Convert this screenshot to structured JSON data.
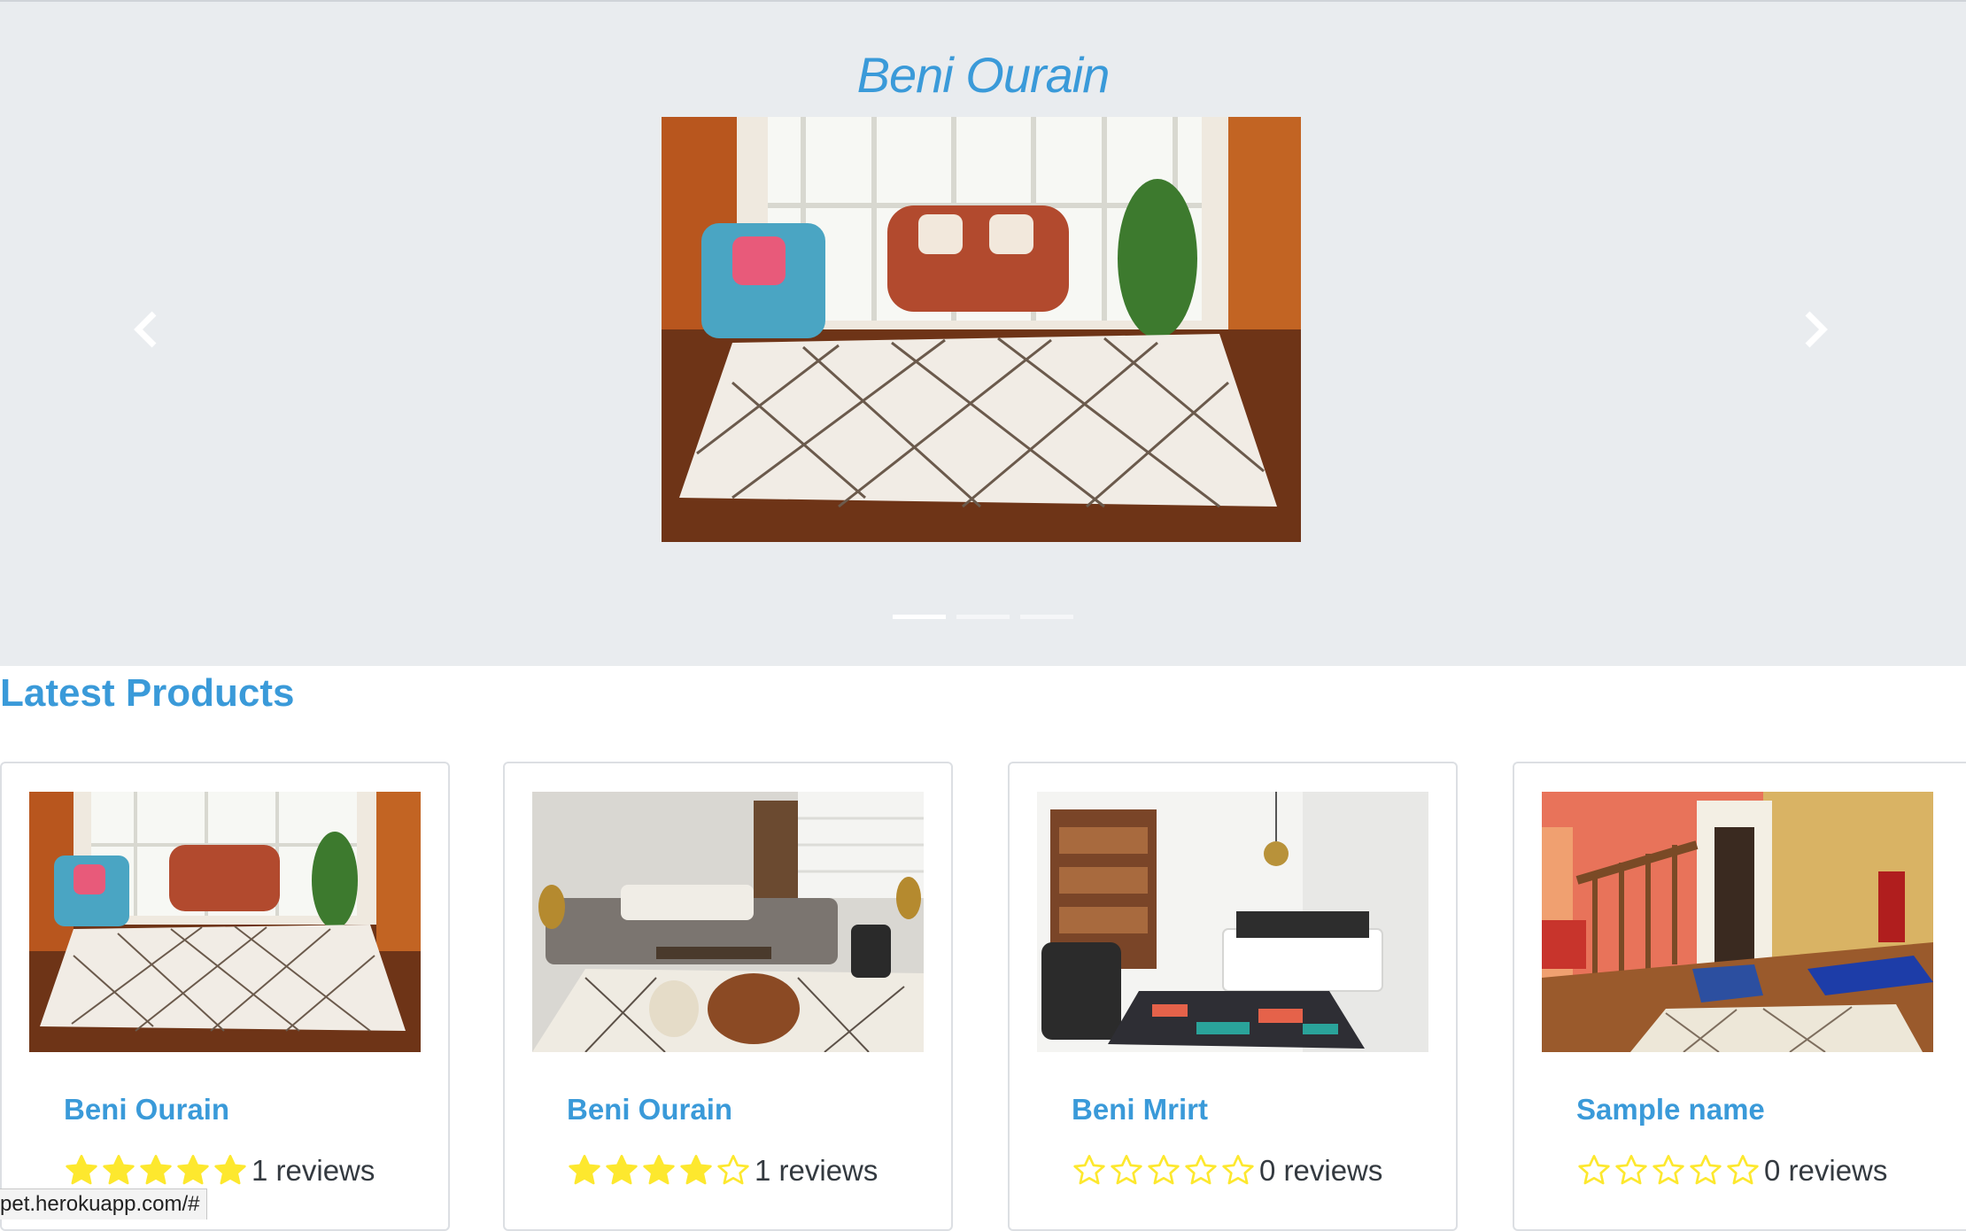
{
  "carousel": {
    "title": "Beni Ourain",
    "prev_icon": "chevron-left-icon",
    "next_icon": "chevron-right-icon",
    "slide_count": 3,
    "active_slide": 1
  },
  "latest": {
    "heading": "Latest Products",
    "products": [
      {
        "name": "Beni Ourain",
        "rating": 5,
        "reviews": "1 reviews",
        "image": "living-room-diamond-rug"
      },
      {
        "name": "Beni Ourain",
        "rating": 4,
        "reviews": "1 reviews",
        "image": "lounge-rug-pouf"
      },
      {
        "name": "Beni Mrirt",
        "rating": 0,
        "reviews": "0 reviews",
        "image": "bedroom-boucherouite-rug"
      },
      {
        "name": "Sample name",
        "rating": 0,
        "reviews": "0 reviews",
        "image": "orange-hall-rug"
      }
    ]
  },
  "status_bar": {
    "url": "pet.herokuapp.com/#"
  },
  "colors": {
    "accent": "#3a9ad9",
    "carousel_bg": "#e9ecef",
    "star": "#fde82e"
  }
}
